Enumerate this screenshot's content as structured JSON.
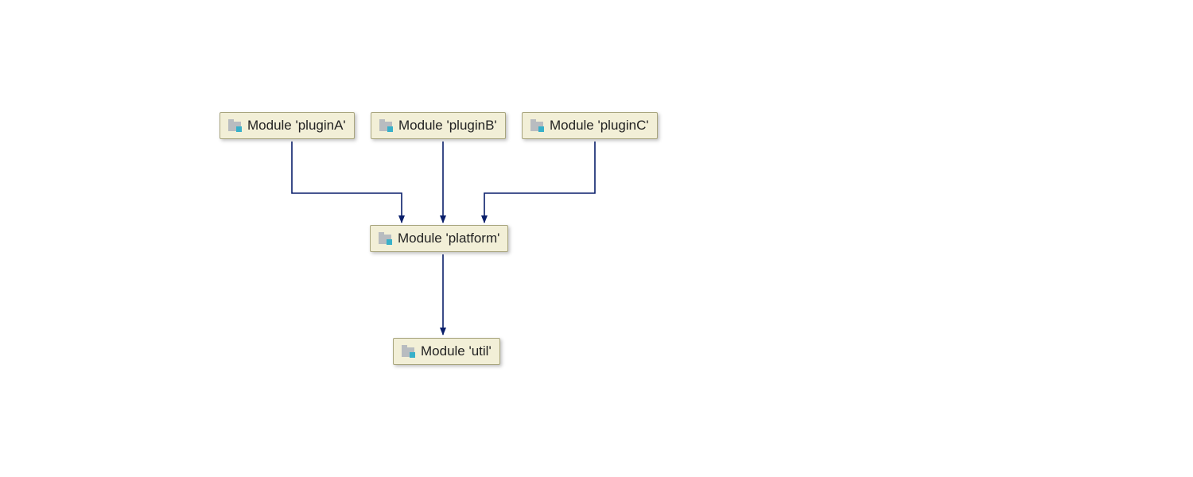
{
  "diagram": {
    "nodes": {
      "pluginA": {
        "label": "Module 'pluginA'"
      },
      "pluginB": {
        "label": "Module 'pluginB'"
      },
      "pluginC": {
        "label": "Module 'pluginC'"
      },
      "platform": {
        "label": "Module 'platform'"
      },
      "util": {
        "label": "Module 'util'"
      }
    },
    "edges": [
      {
        "from": "pluginA",
        "to": "platform"
      },
      {
        "from": "pluginB",
        "to": "platform"
      },
      {
        "from": "pluginC",
        "to": "platform"
      },
      {
        "from": "platform",
        "to": "util"
      }
    ],
    "colors": {
      "nodeFill": "#f2efd7",
      "nodeBorder": "#a8a57e",
      "arrow": "#0a1f6b"
    }
  }
}
